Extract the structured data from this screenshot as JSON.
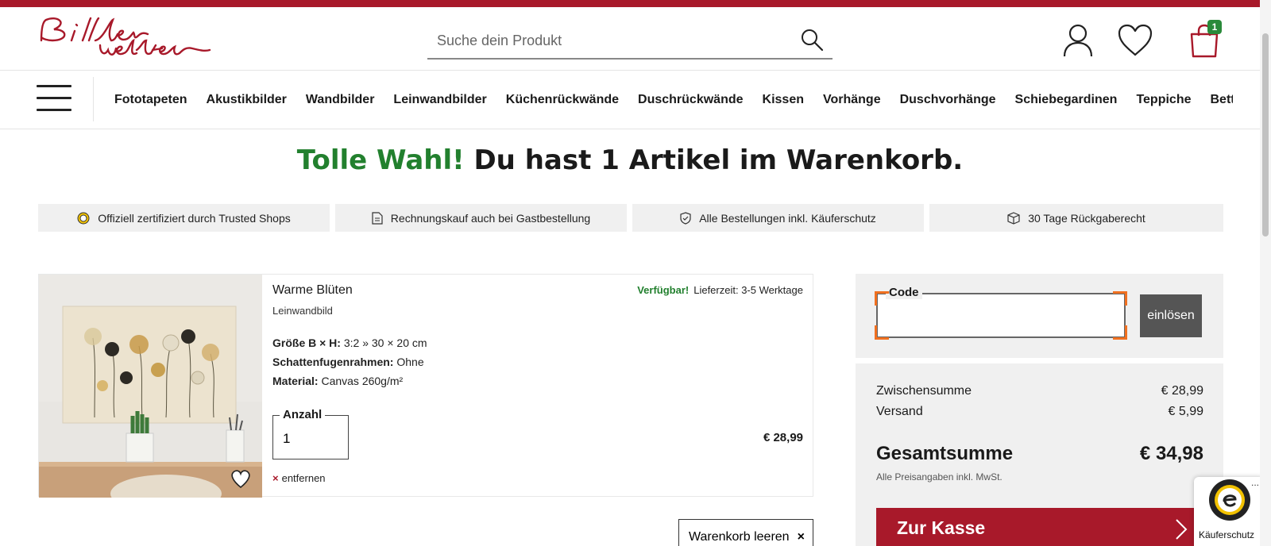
{
  "header": {
    "logo_text": "Bilderwelten",
    "search_placeholder": "Suche dein Produkt",
    "cart_count": "1"
  },
  "nav": {
    "items": [
      "Fototapeten",
      "Akustikbilder",
      "Wandbilder",
      "Leinwandbilder",
      "Küchenrückwände",
      "Duschrückwände",
      "Kissen",
      "Vorhänge",
      "Duschvorhänge",
      "Schiebegardinen",
      "Teppiche",
      "Bettrück"
    ]
  },
  "hero": {
    "highlight": "Tolle Wahl!",
    "text": " Du hast 1 Artikel im Warenkorb."
  },
  "trust": [
    {
      "icon": "trusted-shops-icon",
      "label": "Offiziell zertifiziert durch Trusted Shops"
    },
    {
      "icon": "invoice-icon",
      "label": "Rechnungskauf auch bei Gastbestellung"
    },
    {
      "icon": "shield-check-icon",
      "label": "Alle Bestellungen inkl. Käuferschutz"
    },
    {
      "icon": "package-icon",
      "label": "30 Tage Rückgaberecht"
    }
  ],
  "item": {
    "name": "Warme Blüten",
    "type": "Leinwandbild",
    "available": "Verfügbar!",
    "delivery": "Lieferzeit: 3-5 Werktage",
    "specs": [
      {
        "label": "Größe B × H:",
        "value": " 3:2 » 30 × 20 cm"
      },
      {
        "label": "Schattenfugenrahmen:",
        "value": " Ohne"
      },
      {
        "label": "Material:",
        "value": " Canvas 260g/m²"
      }
    ],
    "qty_label": "Anzahl",
    "qty_value": "1",
    "remove_label": "entfernen",
    "price": "€ 28,99"
  },
  "empty_cart_label": "Warenkorb leeren",
  "coupon": {
    "code_label": "Code",
    "redeem_label": "einlösen"
  },
  "summary": {
    "subtotal_label": "Zwischensumme",
    "subtotal_value": "€ 28,99",
    "shipping_label": "Versand",
    "shipping_value": "€ 5,99",
    "total_label": "Gesamtsumme",
    "total_value": "€ 34,98",
    "tax_note": "Alle Preisangaben inkl. MwSt.",
    "checkout_label": "Zur Kasse"
  },
  "ts_badge": {
    "label": "Käuferschutz",
    "dots": "..."
  },
  "colors": {
    "brand_red": "#a8192a",
    "success_green": "#22802e",
    "panel_gray": "#f0f0f0",
    "focus_orange": "#f07020"
  }
}
